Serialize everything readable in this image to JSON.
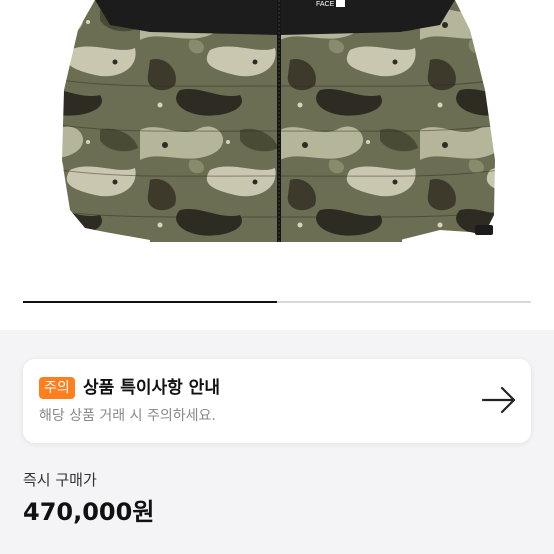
{
  "product": {
    "image_icon": "camo-puffer-jacket",
    "brand_tag": "FACE",
    "carousel_progress": 0.5
  },
  "notice": {
    "badge": "주의",
    "title": "상품 특이사항 안내",
    "subtitle": "해당 상품 거래 시 주의하세요.",
    "arrow_icon": "arrow-right-icon",
    "badge_color": "#ff7f1f"
  },
  "price": {
    "label": "즉시 구매가",
    "value": "470,000원"
  }
}
